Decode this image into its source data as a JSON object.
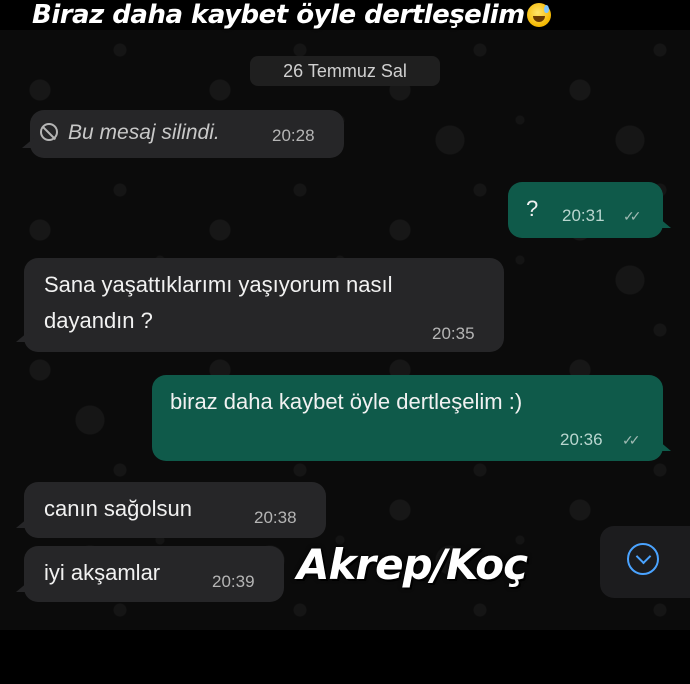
{
  "caption": "Biraz daha kaybet öyle dertleşelim",
  "date_separator": "26 Temmuz Sal",
  "messages": [
    {
      "text": "Bu mesaj silindi.",
      "time": "20:28"
    },
    {
      "text": "?",
      "time": "20:31"
    },
    {
      "text_line1": "Sana yaşattıklarımı yaşıyorum nasıl",
      "text_line2": "dayandın ?",
      "time": "20:35"
    },
    {
      "text": "biraz daha kaybet öyle dertleşelim :)",
      "time": "20:36"
    },
    {
      "text": "canın sağolsun",
      "time": "20:38"
    },
    {
      "text": "iyi akşamlar",
      "time": "20:39"
    }
  ],
  "sticker": "Akrep/Koç",
  "read_ticks": "✓✓",
  "colors": {
    "incoming_bubble": "#262628",
    "outgoing_bubble": "#0f5a4a",
    "accent_blue": "#4aa3ff"
  },
  "icons": [
    "deleted-message-icon",
    "read-receipt-icon",
    "scroll-down-icon",
    "sweat-smile-emoji"
  ]
}
